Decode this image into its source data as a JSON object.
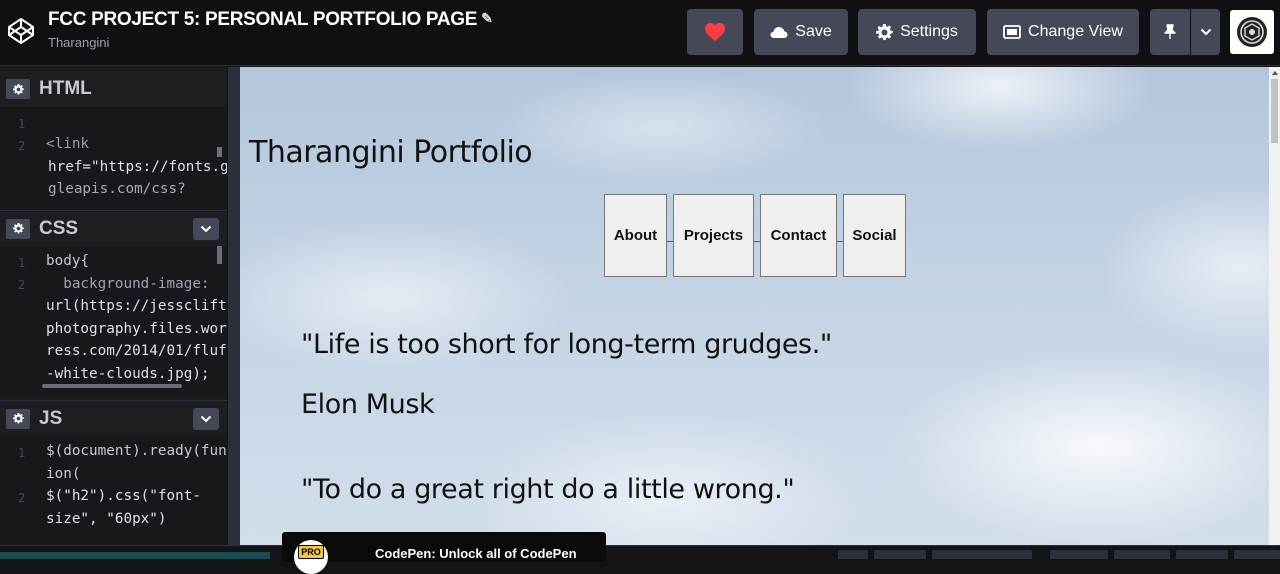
{
  "header": {
    "title": "FCC PROJECT 5: PERSONAL PORTFOLIO PAGE",
    "author": "Tharangini",
    "buttons": {
      "save": "Save",
      "settings": "Settings",
      "change_view": "Change View"
    },
    "icons": {
      "logo": "codepen-logo-icon",
      "edit": "pencil-icon",
      "heart": "heart-icon",
      "save": "cloud-icon",
      "settings": "gear-icon",
      "change_view": "layout-icon",
      "pin": "pin-icon",
      "menu": "chevron-down-icon",
      "avatar": "user-avatar"
    },
    "heart_color": "#ff3c41"
  },
  "editors": {
    "html": {
      "title": "HTML",
      "lines": [
        "<link",
        "href=\"https://fonts.g",
        "gleapis.com/css?"
      ],
      "line_numbers": [
        "1",
        "2"
      ]
    },
    "css": {
      "title": "CSS",
      "lines": [
        "body{",
        "  background-image:",
        "url(https://jessclift",
        "photography.files.wor",
        "ress.com/2014/01/fluf",
        "-white-clouds.jpg);"
      ],
      "line_numbers": [
        "1",
        "2"
      ]
    },
    "js": {
      "title": "JS",
      "lines": [
        "$(document).ready(fun",
        "ion(",
        "$(\"h2\").css(\"font-",
        "size\", \"60px\")"
      ],
      "line_numbers": [
        "1",
        "2"
      ]
    }
  },
  "preview": {
    "site_title": "Tharangini Portfolio",
    "nav": [
      "About",
      "Projects",
      "Contact",
      "Social"
    ],
    "quote1": "\"Life is too short for long-term grudges.\"",
    "quote_author": "Elon Musk",
    "quote2": "\"To do a great right do a little wrong.\""
  },
  "toast": {
    "badge": "PRO",
    "text": "CodePen: Unlock all of CodePen"
  }
}
